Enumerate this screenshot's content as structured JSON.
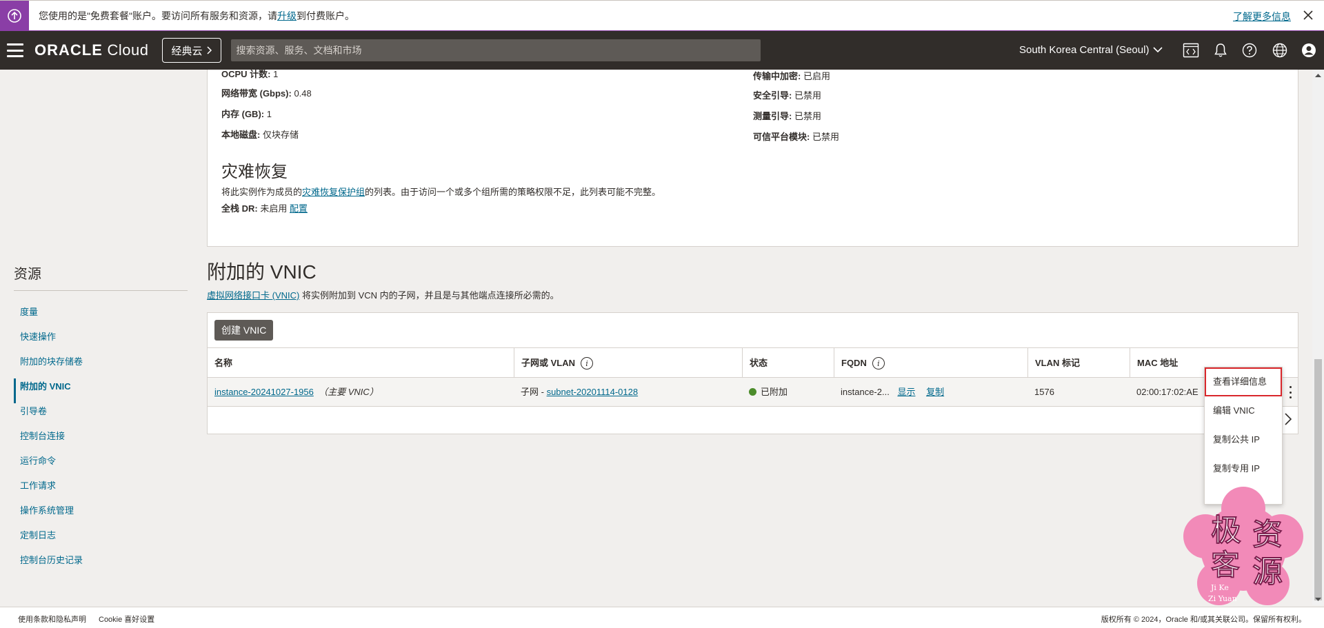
{
  "banner": {
    "text_prefix": "您使用的是\"免费套餐\"账户。要访问所有服务和资源，请",
    "upgrade_link": "升级",
    "text_suffix": "到付费账户。",
    "learn_more": "了解更多信息"
  },
  "nav": {
    "brand_bold": "ORACLE",
    "brand_light": " Cloud",
    "classic_label": "经典云",
    "search_placeholder": "搜索资源、服务、文档和市场",
    "region": "South Korea Central (Seoul)"
  },
  "details": {
    "ocpu": {
      "key": "OCPU 计数:",
      "value": " 1"
    },
    "bandwidth": {
      "key": "网络带宽 (Gbps):",
      "value": " 0.48"
    },
    "memory": {
      "key": "内存 (GB):",
      "value": " 1"
    },
    "local_disk": {
      "key": "本地磁盘:",
      "value": " 仅块存储"
    },
    "in_transit": {
      "key": "传输中加密:",
      "value": " 已启用"
    },
    "secure_boot": {
      "key": "安全引导:",
      "value": " 已禁用"
    },
    "measured_boot": {
      "key": "测量引导:",
      "value": " 已禁用"
    },
    "tpm": {
      "key": "可信平台模块:",
      "value": " 已禁用"
    }
  },
  "disaster_recovery": {
    "title": "灾难恢复",
    "text_prefix": "将此实例作为成员的",
    "link": "灾难恢复保护组",
    "text_suffix": "的列表。由于访问一个或多个组所需的策略权限不足，此列表可能不完整。",
    "full_stack_key": "全栈 DR:",
    "full_stack_value": " 未启用 ",
    "configure": "配置"
  },
  "resources": {
    "title": "资源",
    "items": [
      "度量",
      "快速操作",
      "附加的块存储卷",
      "附加的 VNIC",
      "引导卷",
      "控制台连接",
      "运行命令",
      "工作请求",
      "操作系统管理",
      "定制日志",
      "控制台历史记录"
    ],
    "active_index": 3
  },
  "vnic": {
    "title": "附加的 VNIC",
    "desc_link": "虚拟网络接口卡 (VNIC)",
    "desc_text": " 将实例附加到 VCN 内的子网，并且是与其他端点连接所必需的。",
    "create_button": "创建 VNIC",
    "columns": [
      "名称",
      "子网或 VLAN",
      "状态",
      "FQDN",
      "VLAN 标记",
      "MAC 地址"
    ],
    "row": {
      "name": "instance-20241027-1956",
      "primary": "（主要 VNIC）",
      "subnet_prefix": "子网 - ",
      "subnet": "subnet-20201114-0128",
      "status": "已附加",
      "status_color": "#4c8c2b",
      "fqdn": "instance-2...",
      "fqdn_show": "显示",
      "fqdn_copy": "复制",
      "vlan_tag": "1576",
      "mac": "02:00:17:02:AE"
    }
  },
  "action_menu": {
    "items": [
      "查看详细信息",
      "编辑 VNIC",
      "复制公共 IP",
      "复制专用 IP"
    ],
    "highlight_color": "#d9262b"
  },
  "footer": {
    "terms": "使用条款和隐私声明",
    "cookie": "Cookie 喜好设置",
    "copyright": "版权所有 © 2024，Oracle 和/或其关联公司。保留所有权利。"
  },
  "watermark": {
    "chars": [
      "极",
      "资",
      "客",
      "源"
    ],
    "latin_1": "Ji Ke",
    "latin_2": "Zi Yuan"
  },
  "colors": {
    "accent": "#8a3ea6",
    "nav_bg": "#312d2a",
    "link": "#00688c"
  }
}
